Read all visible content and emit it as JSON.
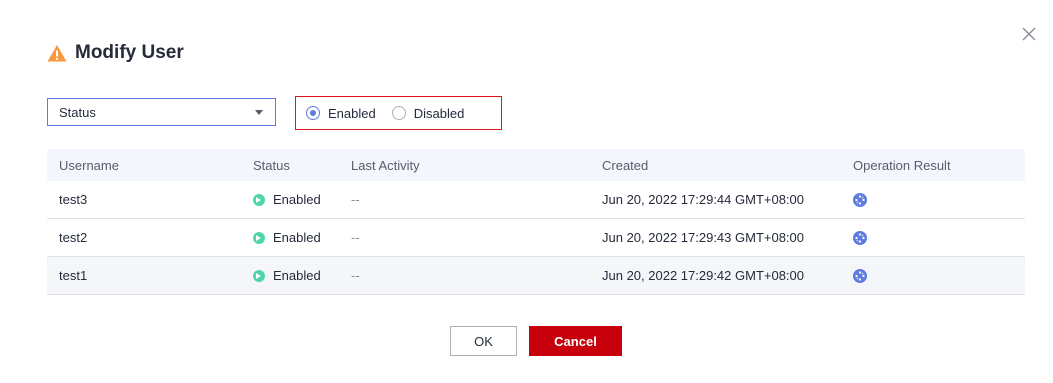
{
  "dialog": {
    "title": "Modify User",
    "ok_label": "OK",
    "cancel_label": "Cancel"
  },
  "filter": {
    "select_value": "Status",
    "options": [
      {
        "label": "Enabled",
        "checked": true
      },
      {
        "label": "Disabled",
        "checked": false
      }
    ]
  },
  "table": {
    "headers": [
      "Username",
      "Status",
      "Last Activity",
      "Created",
      "Operation Result"
    ],
    "rows": [
      {
        "username": "test3",
        "status": "Enabled",
        "last_activity": "--",
        "created": "Jun 20, 2022 17:29:44 GMT+08:00"
      },
      {
        "username": "test2",
        "status": "Enabled",
        "last_activity": "--",
        "created": "Jun 20, 2022 17:29:43 GMT+08:00"
      },
      {
        "username": "test1",
        "status": "Enabled",
        "last_activity": "--",
        "created": "Jun 20, 2022 17:29:42 GMT+08:00"
      }
    ]
  },
  "colors": {
    "accent": "#5e7ce0",
    "danger": "#c7000b",
    "warning": "#fa9841",
    "success": "#50d4ab"
  },
  "icons": {
    "title": "warning-icon",
    "close": "close-icon",
    "status": "status-enabled-icon",
    "result": "loading-spinner-icon"
  }
}
